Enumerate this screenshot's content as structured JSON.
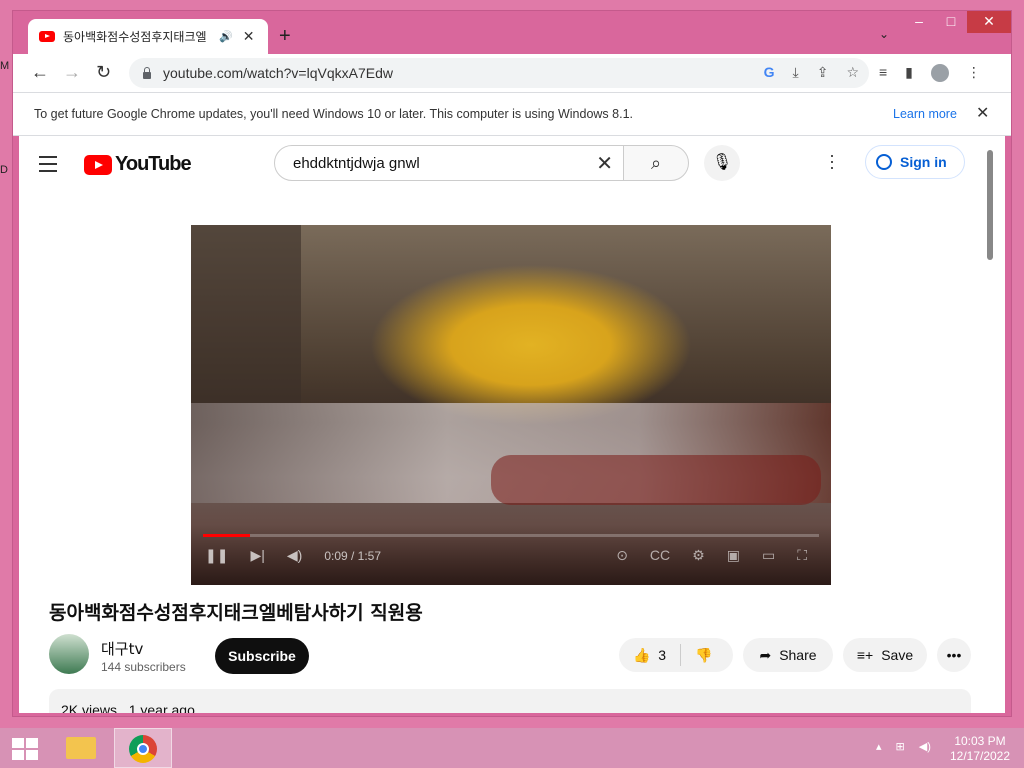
{
  "browser": {
    "tab": {
      "title": "동아백화점수성점후지태크엘",
      "audio_icon": "speaker-icon"
    },
    "new_tab": "+",
    "url": "youtube.com/watch?v=lqVqkxA7Edw",
    "infobar": {
      "message": "To get future Google Chrome updates, you'll need Windows 10 or later. This computer is using Windows 8.1.",
      "learn_more": "Learn more"
    }
  },
  "youtube": {
    "logo_text": "YouTube",
    "search": {
      "value": "ehddktntjdwja gnwl"
    },
    "sign_in": "Sign in",
    "player": {
      "time": "0:09 / 1:57",
      "progress_fraction": 0.077
    },
    "video_title": "동아백화점수성점후지태크엘베탐사하기 직원용",
    "channel": {
      "name": "대구tv",
      "subscribers": "144 subscribers"
    },
    "subscribe_label": "Subscribe",
    "actions": {
      "likes": "3",
      "share": "Share",
      "save": "Save"
    },
    "description": {
      "views": "2K views",
      "age": "1 year ago"
    }
  },
  "taskbar": {
    "time": "10:03 PM",
    "date": "12/17/2022"
  },
  "colors": {
    "brand_red": "#ff0000",
    "link_blue": "#065fd4",
    "desktop_pink": "#e07aa8"
  }
}
